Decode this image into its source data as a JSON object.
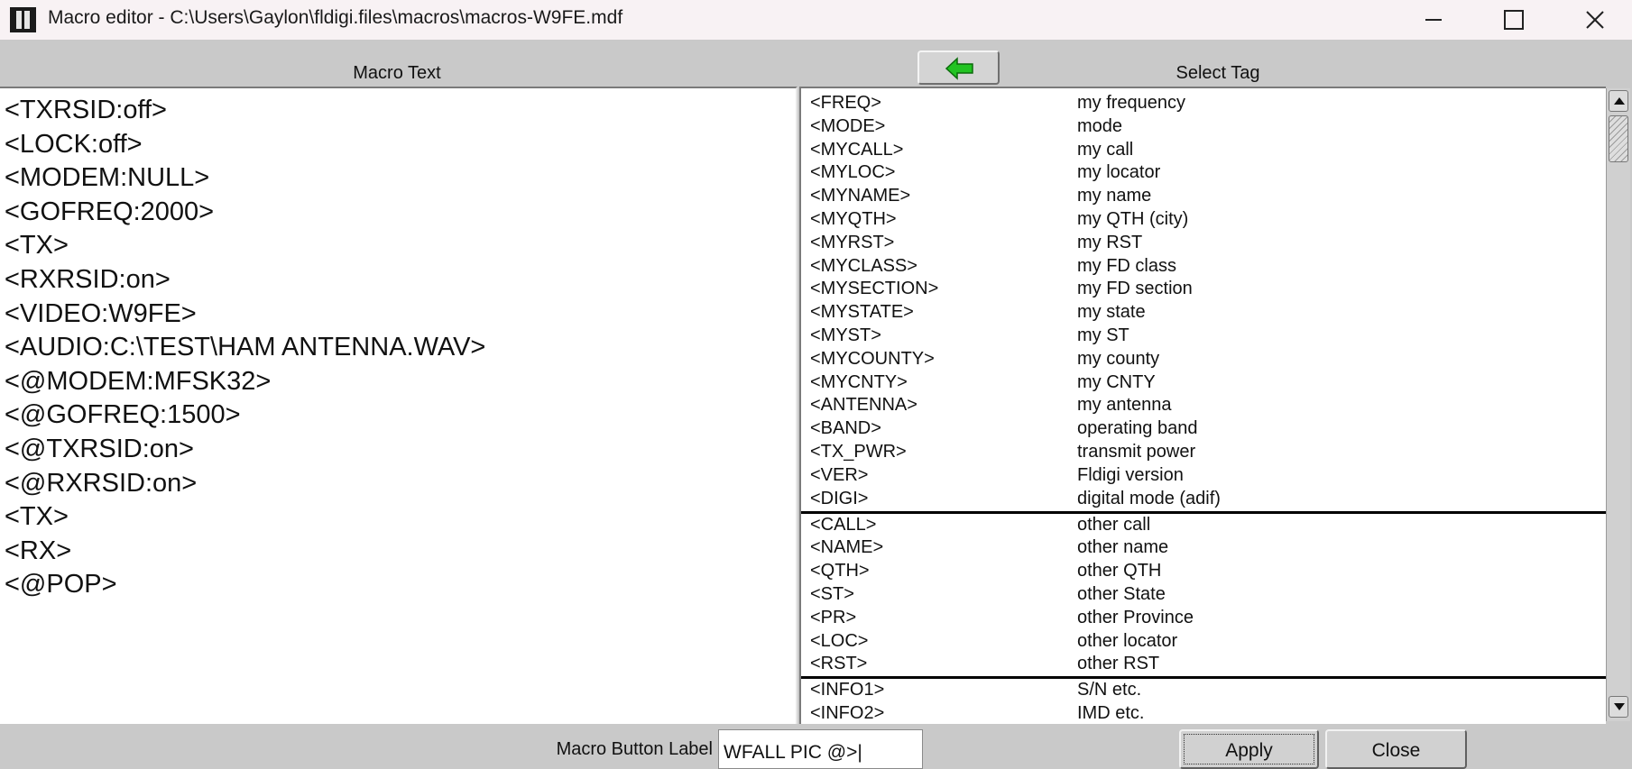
{
  "window": {
    "title": "Macro editor - C:\\Users\\Gaylon\\fldigi.files\\macros\\macros-W9FE.mdf"
  },
  "headers": {
    "macro_text": "Macro Text",
    "select_tag": "Select Tag"
  },
  "icons": {
    "app": "fldigi-app-icon",
    "transfer": "green-left-arrow-icon"
  },
  "colors": {
    "arrow_green": "#22c322",
    "title_bar": "#f8f2f4",
    "dialog_bg": "#c9c9c9"
  },
  "macro_lines": [
    "<TXRSID:off>",
    "<LOCK:off>",
    "<MODEM:NULL>",
    "<GOFREQ:2000>",
    "<TX>",
    "<RXRSID:on>",
    "<VIDEO:W9FE>",
    "<AUDIO:C:\\TEST\\HAM ANTENNA.WAV>",
    "<@MODEM:MFSK32>",
    "<@GOFREQ:1500>",
    "<@TXRSID:on>",
    "<@RXRSID:on>",
    "<TX>",
    "<RX>",
    "<@POP>"
  ],
  "tags": [
    {
      "tag": "<FREQ>",
      "desc": "my frequency"
    },
    {
      "tag": "<MODE>",
      "desc": "mode"
    },
    {
      "tag": "<MYCALL>",
      "desc": "my call"
    },
    {
      "tag": "<MYLOC>",
      "desc": "my locator"
    },
    {
      "tag": "<MYNAME>",
      "desc": "my name"
    },
    {
      "tag": "<MYQTH>",
      "desc": "my QTH (city)"
    },
    {
      "tag": "<MYRST>",
      "desc": "my RST"
    },
    {
      "tag": "<MYCLASS>",
      "desc": "my FD class"
    },
    {
      "tag": "<MYSECTION>",
      "desc": "my FD section"
    },
    {
      "tag": "<MYSTATE>",
      "desc": "my state"
    },
    {
      "tag": "<MYST>",
      "desc": "my ST"
    },
    {
      "tag": "<MYCOUNTY>",
      "desc": "my county"
    },
    {
      "tag": "<MYCNTY>",
      "desc": "my CNTY"
    },
    {
      "tag": "<ANTENNA>",
      "desc": "my antenna"
    },
    {
      "tag": "<BAND>",
      "desc": "operating band"
    },
    {
      "tag": "<TX_PWR>",
      "desc": "transmit power"
    },
    {
      "tag": "<VER>",
      "desc": "Fldigi version"
    },
    {
      "tag": "<DIGI>",
      "desc": "digital mode (adif)"
    },
    {
      "tag": "<CALL>",
      "desc": "other call"
    },
    {
      "tag": "<NAME>",
      "desc": "other name"
    },
    {
      "tag": "<QTH>",
      "desc": "other QTH"
    },
    {
      "tag": "<ST>",
      "desc": "other State"
    },
    {
      "tag": "<PR>",
      "desc": "other Province"
    },
    {
      "tag": "<LOC>",
      "desc": "other locator"
    },
    {
      "tag": "<RST>",
      "desc": "other RST"
    },
    {
      "tag": "<INFO1>",
      "desc": "S/N etc."
    },
    {
      "tag": "<INFO2>",
      "desc": "IMD etc."
    }
  ],
  "bottom": {
    "label": "Macro Button Label",
    "label_value": "WFALL PIC @>|",
    "apply": "Apply",
    "close": "Close"
  }
}
